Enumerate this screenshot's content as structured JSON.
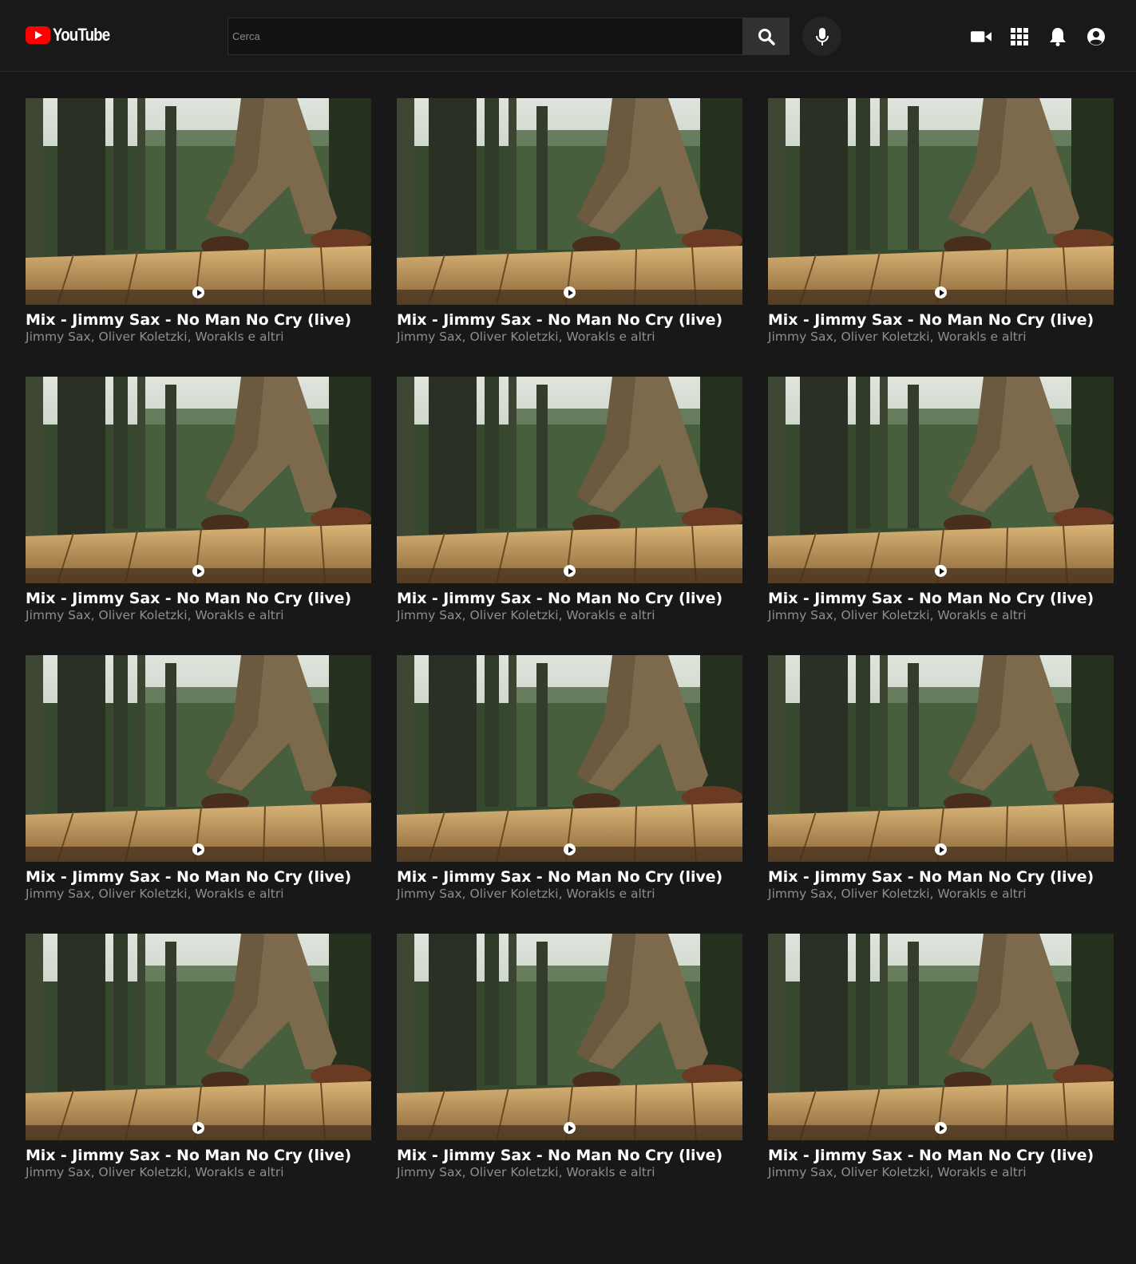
{
  "header": {
    "logo_text": "YouTube",
    "search_placeholder": "Cerca",
    "icons": [
      "search-icon",
      "mic-icon",
      "video-camera-icon",
      "apps-grid-icon",
      "bell-icon",
      "account-icon"
    ]
  },
  "colors": {
    "background": "#181818",
    "brand_red": "#ff0000",
    "title": "#ffffff",
    "subtitle": "#8e8e8e"
  },
  "videos": [
    {
      "title": "Mix - Jimmy Sax - No Man No Cry (live)",
      "channels": "Jimmy Sax, Oliver Koletzki, Worakls e altri"
    },
    {
      "title": "Mix - Jimmy Sax - No Man No Cry (live)",
      "channels": "Jimmy Sax, Oliver Koletzki, Worakls e altri"
    },
    {
      "title": "Mix - Jimmy Sax - No Man No Cry (live)",
      "channels": "Jimmy Sax, Oliver Koletzki, Worakls e altri"
    },
    {
      "title": "Mix - Jimmy Sax - No Man No Cry (live)",
      "channels": "Jimmy Sax, Oliver Koletzki, Worakls e altri"
    },
    {
      "title": "Mix - Jimmy Sax - No Man No Cry (live)",
      "channels": "Jimmy Sax, Oliver Koletzki, Worakls e altri"
    },
    {
      "title": "Mix - Jimmy Sax - No Man No Cry (live)",
      "channels": "Jimmy Sax, Oliver Koletzki, Worakls e altri"
    },
    {
      "title": "Mix - Jimmy Sax - No Man No Cry (live)",
      "channels": "Jimmy Sax, Oliver Koletzki, Worakls e altri"
    },
    {
      "title": "Mix - Jimmy Sax - No Man No Cry (live)",
      "channels": "Jimmy Sax, Oliver Koletzki, Worakls e altri"
    },
    {
      "title": "Mix - Jimmy Sax - No Man No Cry (live)",
      "channels": "Jimmy Sax, Oliver Koletzki, Worakls e altri"
    },
    {
      "title": "Mix - Jimmy Sax - No Man No Cry (live)",
      "channels": "Jimmy Sax, Oliver Koletzki, Worakls e altri"
    },
    {
      "title": "Mix - Jimmy Sax - No Man No Cry (live)",
      "channels": "Jimmy Sax, Oliver Koletzki, Worakls e altri"
    },
    {
      "title": "Mix - Jimmy Sax - No Man No Cry (live)",
      "channels": "Jimmy Sax, Oliver Koletzki, Worakls e altri"
    }
  ]
}
